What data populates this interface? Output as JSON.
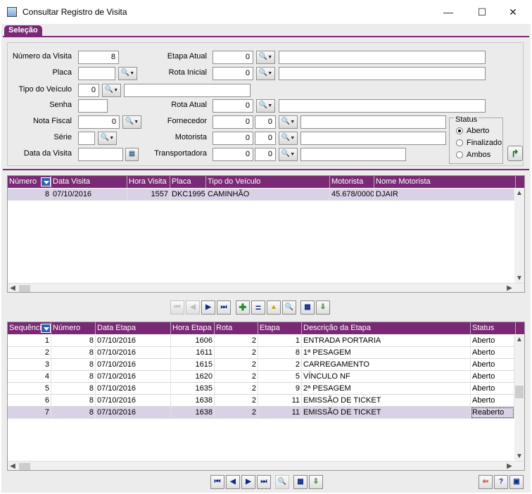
{
  "window": {
    "title": "Consultar Registro de Visita",
    "minimize": "—",
    "maximize": "☐",
    "close": "✕"
  },
  "tab_label": "Seleção",
  "filters": {
    "numero_visita": {
      "label": "Número da Visita",
      "value": "8"
    },
    "placa": {
      "label": "Placa",
      "value": ""
    },
    "tipo_veiculo": {
      "label": "Tipo do Veículo",
      "code": "0",
      "desc": ""
    },
    "senha": {
      "label": "Senha",
      "value": ""
    },
    "nota_fiscal": {
      "label": "Nota Fiscal",
      "value": "0"
    },
    "serie": {
      "label": "Série",
      "value": ""
    },
    "data_visita": {
      "label": "Data da Visita",
      "value": ""
    },
    "etapa_atual": {
      "label": "Etapa Atual",
      "code": "0",
      "desc": ""
    },
    "rota_inicial": {
      "label": "Rota Inicial",
      "code": "0",
      "desc": ""
    },
    "rota_atual": {
      "label": "Rota Atual",
      "code": "0",
      "desc": ""
    },
    "fornecedor": {
      "label": "Fornecedor",
      "code1": "0",
      "code2": "0",
      "desc": ""
    },
    "motorista": {
      "label": "Motorista",
      "code1": "0",
      "code2": "0",
      "desc": ""
    },
    "transportadora": {
      "label": "Transportadora",
      "code1": "0",
      "code2": "0",
      "desc": ""
    }
  },
  "status": {
    "title": "Status",
    "options": [
      "Aberto",
      "Finalizado",
      "Ambos"
    ],
    "selected": "Aberto"
  },
  "visits": {
    "headers": [
      "Número",
      "Data Visita",
      "Hora Visita",
      "Placa",
      "Tipo do Veículo",
      "Motorista",
      "Nome Motorista"
    ],
    "rows": [
      [
        "8",
        "07/10/2016",
        "1557",
        "DKC1995",
        "CAMINHÃO",
        "45.678/0000",
        "DJAIR"
      ]
    ]
  },
  "steps": {
    "headers": [
      "Sequência",
      "Número",
      "Data Etapa",
      "Hora Etapa",
      "Rota",
      "Etapa",
      "Descrição da Etapa",
      "Status"
    ],
    "rows": [
      [
        "1",
        "8",
        "07/10/2016",
        "1606",
        "2",
        "1",
        "ENTRADA PORTARIA",
        "Aberto"
      ],
      [
        "2",
        "8",
        "07/10/2016",
        "1611",
        "2",
        "8",
        "1ª PESAGEM",
        "Aberto"
      ],
      [
        "3",
        "8",
        "07/10/2016",
        "1615",
        "2",
        "2",
        "CARREGAMENTO",
        "Aberto"
      ],
      [
        "4",
        "8",
        "07/10/2016",
        "1620",
        "2",
        "5",
        "VÍNCULO NF",
        "Aberto"
      ],
      [
        "5",
        "8",
        "07/10/2016",
        "1635",
        "2",
        "9",
        "2ª PESAGEM",
        "Aberto"
      ],
      [
        "6",
        "8",
        "07/10/2016",
        "1638",
        "2",
        "11",
        "EMISSÃO DE TICKET",
        "Aberto"
      ],
      [
        "7",
        "8",
        "07/10/2016",
        "1638",
        "2",
        "11",
        "EMISSÃO DE TICKET",
        "Reaberto"
      ]
    ]
  },
  "toolbar_icons": {
    "first": "⏮",
    "prev": "◀",
    "next": "▶",
    "last": "⏭",
    "add": "✚",
    "equals": "=",
    "up": "▲",
    "search": "🔍",
    "grid": "▦",
    "export": "⇩",
    "exit": "⇦",
    "help": "?",
    "print": "▣",
    "lookup": "🔍",
    "calendar": "▦",
    "go": "↱"
  }
}
